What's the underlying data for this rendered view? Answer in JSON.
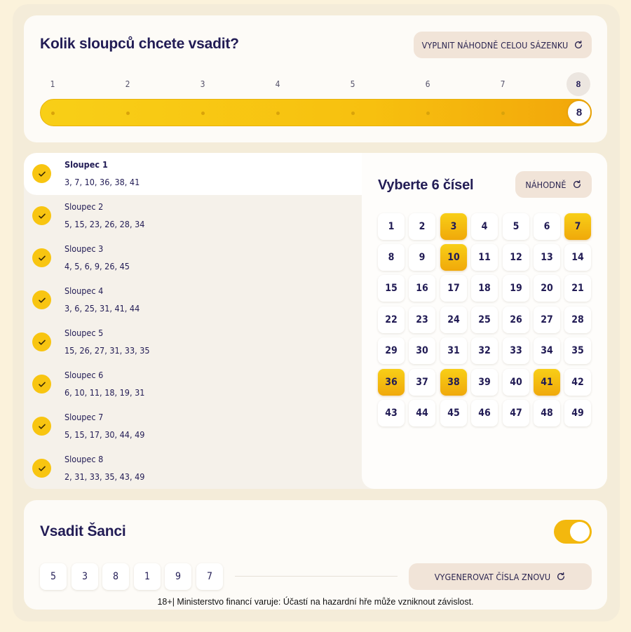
{
  "top": {
    "title": "Kolik sloupců chcete vsadit?",
    "random_all_label": "VYPLNIT NÁHODNĚ CELOU SÁZENKU",
    "ticks": [
      "1",
      "2",
      "3",
      "4",
      "5",
      "6",
      "7",
      "8"
    ],
    "active_tick": "8",
    "slider_value": "8",
    "slider_selected": 8
  },
  "columns": [
    {
      "name": "Sloupec 1",
      "numbers": "3, 7, 10, 36, 38, 41"
    },
    {
      "name": "Sloupec 2",
      "numbers": "5, 15, 23, 26, 28, 34"
    },
    {
      "name": "Sloupec 3",
      "numbers": "4, 5, 6, 9, 26, 45"
    },
    {
      "name": "Sloupec 4",
      "numbers": "3, 6, 25, 31, 41, 44"
    },
    {
      "name": "Sloupec 5",
      "numbers": "15, 26, 27, 31, 33, 35"
    },
    {
      "name": "Sloupec 6",
      "numbers": "6, 10, 11, 18, 19, 31"
    },
    {
      "name": "Sloupec 7",
      "numbers": "5, 15, 17, 30, 44, 49"
    },
    {
      "name": "Sloupec 8",
      "numbers": "2, 31, 33, 35, 43, 49"
    }
  ],
  "picker": {
    "title": "Vyberte 6 čísel",
    "random_label": "NÁHODNĚ",
    "numbers": [
      "1",
      "2",
      "3",
      "4",
      "5",
      "6",
      "7",
      "8",
      "9",
      "10",
      "11",
      "12",
      "13",
      "14",
      "15",
      "16",
      "17",
      "18",
      "19",
      "20",
      "21",
      "22",
      "23",
      "24",
      "25",
      "26",
      "27",
      "28",
      "29",
      "30",
      "31",
      "32",
      "33",
      "34",
      "35",
      "36",
      "37",
      "38",
      "39",
      "40",
      "41",
      "42",
      "43",
      "44",
      "45",
      "46",
      "47",
      "48",
      "49"
    ],
    "selected": [
      "3",
      "7",
      "10",
      "36",
      "38",
      "41"
    ]
  },
  "sance": {
    "title": "Vsadit Šanci",
    "toggle_on": true,
    "digits": [
      "5",
      "3",
      "8",
      "1",
      "9",
      "7"
    ],
    "regenerate_label": "VYGENEROVAT ČÍSLA ZNOVU"
  },
  "disclaimer": "18+| Ministerstvo financí varuje: Účastí na hazardní hře může vzniknout závislost.",
  "colors": {
    "accent": "#f8c511",
    "navy": "#221c55",
    "button_bg": "#f1e4d8"
  },
  "icons": {
    "refresh": "refresh-icon",
    "check": "check-icon"
  }
}
